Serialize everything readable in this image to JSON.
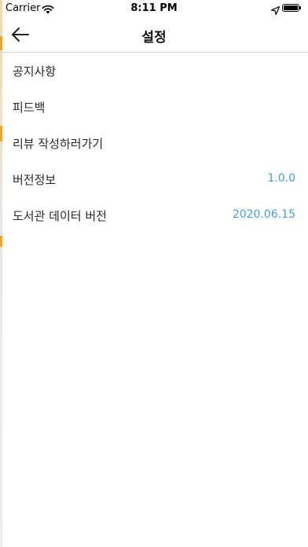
{
  "status_bar": {
    "carrier": "Carrier",
    "time": "8:11 PM",
    "icons": [
      "wifi-icon",
      "location-arrow-icon",
      "battery-icon"
    ]
  },
  "nav": {
    "title": "설정",
    "back_icon": "back-arrow-icon"
  },
  "settings": {
    "items": [
      {
        "label": "공지사항"
      },
      {
        "label": "피드백"
      },
      {
        "label": "리뷰 작성하러가기"
      },
      {
        "label": "버전정보",
        "value": "1.0.0"
      },
      {
        "label": "도서관 데이터 버전",
        "value": "2020.06.15"
      }
    ]
  },
  "colors": {
    "value_text": "#4a9fd8",
    "divider": "#d6d6d6",
    "accent_edge": "#f0a52a"
  }
}
